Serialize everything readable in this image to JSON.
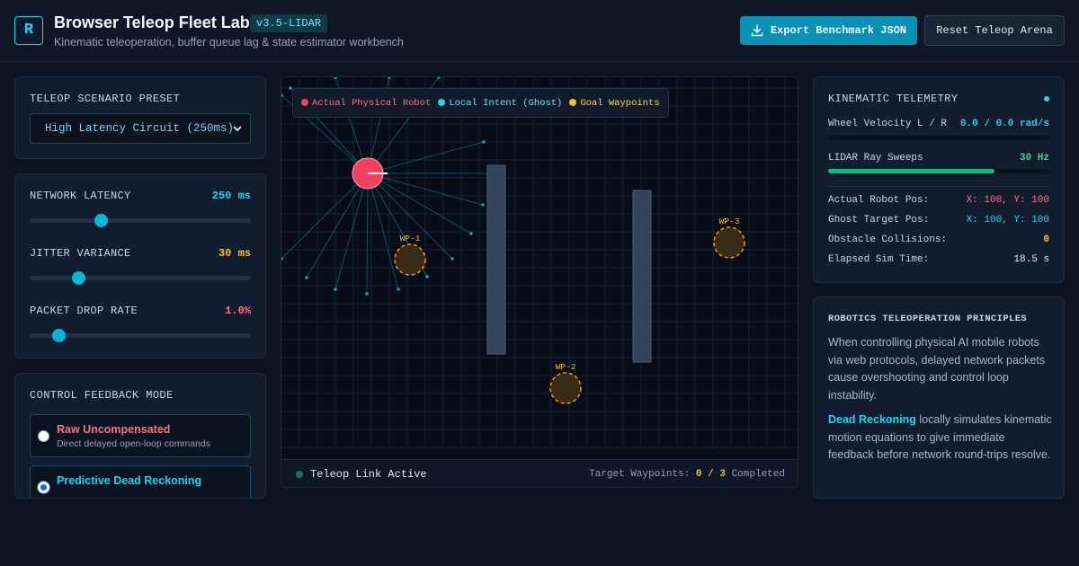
{
  "app": {
    "logo": "R",
    "title": "Browser Teleop Fleet Lab",
    "version": "v3.5-LIDAR",
    "subtitle": "Kinematic teleoperation, buffer queue lag & state estimator workbench",
    "export_label": "Export Benchmark JSON",
    "reset_label": "Reset Teleop Arena",
    "export_icon": "download-icon"
  },
  "scenario": {
    "title": "TELEOP SCENARIO PRESET",
    "selected": "High Latency Circuit (250ms)"
  },
  "network": {
    "sliders": [
      {
        "label": "NETWORK LATENCY",
        "value": "250 ms",
        "color": "#22d3ee",
        "level": 0.32
      },
      {
        "label": "JITTER VARIANCE",
        "value": "30 ms",
        "color": "#fbbf24",
        "level": 0.22
      },
      {
        "label": "PACKET DROP RATE",
        "value": "1.0%",
        "color": "#fb7185",
        "level": 0.13
      }
    ]
  },
  "feedback": {
    "title": "CONTROL FEEDBACK MODE",
    "options": [
      {
        "title": "Raw Uncompensated",
        "desc": "Direct delayed open-loop commands",
        "color": "#fb7185",
        "checked": false
      },
      {
        "title": "Predictive Dead Reckoning",
        "desc": "",
        "color": "#22d3ee",
        "checked": true
      }
    ]
  },
  "arena": {
    "legend": [
      {
        "label": "Actual Physical Robot",
        "color": "#f43f5e"
      },
      {
        "label": "Local Intent (Ghost)",
        "color": "#22d3ee"
      },
      {
        "label": "Goal Waypoints",
        "color": "#fbbf24"
      }
    ],
    "waypoints": [
      {
        "label": "WP-1"
      },
      {
        "label": "WP-2"
      },
      {
        "label": "WP-3"
      }
    ],
    "link_status": "Teleop Link Active",
    "waypoints_prefix": "Target Waypoints:",
    "waypoints_done": "0",
    "waypoints_sep": "/",
    "waypoints_total": "3",
    "waypoints_suffix": "Completed"
  },
  "telemetry": {
    "title": "KINEMATIC TELEMETRY",
    "wheel_label": "Wheel Velocity L / R",
    "wheel_value": "0.0 / 0.0 rad/s",
    "wheel_level": 0,
    "lidar_label": "LIDAR Ray Sweeps",
    "lidar_value": "30 Hz",
    "lidar_level": 0.75,
    "rows": [
      {
        "label": "Actual Robot Pos:",
        "value": "X: 100, Y: 100",
        "color": "#fb7185"
      },
      {
        "label": "Ghost Target Pos:",
        "value": "X: 100, Y: 100",
        "color": "#22d3ee"
      },
      {
        "label": "Obstacle Collisions:",
        "value": "0",
        "color": "#fbbf24"
      },
      {
        "label": "Elapsed Sim Time:",
        "value": "18.5 s",
        "color": "#e2e8f0"
      }
    ]
  },
  "principles": {
    "title": "ROBOTICS TELEOPERATION PRINCIPLES",
    "paragraph1": "When controlling physical AI mobile robots via web protocols, delayed network packets cause overshooting and control loop instability.",
    "highlight": "Dead Reckoning",
    "paragraph2_rest": " locally simulates kinematic motion equations to give immediate feedback before network round-trips resolve."
  }
}
